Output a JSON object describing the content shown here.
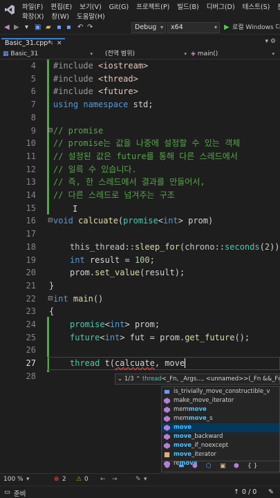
{
  "menu": {
    "row1": [
      "파일(F)",
      "편집(E)",
      "보기(V)",
      "Git(G)",
      "프로젝트(P)",
      "빌드(B)",
      "디버그(D)",
      "테스트(S)",
      "분석"
    ],
    "row2": [
      "확장(X)",
      "창(W)",
      "도움말(H)"
    ]
  },
  "toolbar": {
    "config": "Debug",
    "platform": "x64",
    "run_label": "로컬 Windows 디"
  },
  "tab": {
    "title": "Basic_31.cpp*"
  },
  "navbar": {
    "project": "Basic_31",
    "scope": "(전역 범위)",
    "member": "main()"
  },
  "editor": {
    "line_numbers": [
      "4",
      "5",
      "6",
      "7",
      "8",
      "9",
      "10",
      "11",
      "12",
      "13",
      "14",
      "15",
      "16",
      "17",
      "18",
      "19",
      "20",
      "21",
      "22",
      "23",
      "24",
      "25",
      "26",
      "27",
      "28"
    ],
    "current_line": "27",
    "lines": {
      "l4a": "#include ",
      "l4b": "<iostream>",
      "l5a": "#include ",
      "l5b": "<thread>",
      "l6a": "#include ",
      "l6b": "<future>",
      "l7a": "using namespace ",
      "l7b": "std;",
      "l9": "// promise",
      "l10": "// promise는 값을 나중에 설정할 수 있는 객체",
      "l11": "// 설정된 값은 future를 통해 다른 스레드에서",
      "l12": "// 일륵 수 있습니다.",
      "l13": "// 즉, 한 스레드에서 결과를 만들어서,",
      "l14": "// 다른 스레드로 넘겨주는 구조",
      "l16a": "void ",
      "l16b": "calcuate",
      "l16c": "(",
      "l16d": "promise",
      "l16e": "<",
      "l16f": "int",
      "l16g": "> prom)",
      "l18a": "this_thread",
      "l18b": "::",
      "l18c": "sleep_for",
      "l18d": "(",
      "l18e": "chrono",
      "l18f": "::",
      "l18g": "seconds",
      "l18h": "(",
      "l18i": "2",
      "l18j": "));",
      "l19a": "int ",
      "l19b": "result = ",
      "l19c": "100",
      "l19d": ";",
      "l20a": "prom.",
      "l20b": "set_value",
      "l20c": "(result);",
      "l21": "}",
      "l22a": "int ",
      "l22b": "main",
      "l22c": "()",
      "l23": "{",
      "l24a": "promise",
      "l24b": "<",
      "l24c": "int",
      "l24d": "> prom;",
      "l25a": "future",
      "l25b": "<",
      "l25c": "int",
      "l25d": "> fut = prom.",
      "l25e": "get_future",
      "l25f": "();",
      "l27a": "thread ",
      "l27b": "t(",
      "l27c": "calcuate",
      "l27d": ", move"
    }
  },
  "param_hint": {
    "counter": "1/3",
    "signature_a": "thread",
    "signature_b": "<_Fn, _Args..., <unnamed>>(_Fn &&_Fn, _Ar"
  },
  "completion": {
    "items": [
      {
        "pre": "is_trivially_",
        "match": "move",
        "post": "_constructible_v"
      },
      {
        "pre": "make_",
        "match": "move",
        "post": "_iterator"
      },
      {
        "pre": "mem",
        "match": "move",
        "post": ""
      },
      {
        "pre": "mem",
        "match": "move",
        "post": "_s"
      },
      {
        "pre": "",
        "match": "move",
        "post": ""
      },
      {
        "pre": "",
        "match": "move",
        "post": "_backward"
      },
      {
        "pre": "",
        "match": "move",
        "post": "_if_noexcept"
      },
      {
        "pre": "",
        "match": "move",
        "post": "_iterator"
      },
      {
        "pre": "re",
        "match": "move",
        "post": ""
      }
    ],
    "filter_braces": "{ }"
  },
  "editor_status": {
    "zoom": "100 %",
    "errors": "2",
    "warnings": "0"
  },
  "statusbar": {
    "ready": "준비",
    "problems": "0 / 0",
    "up": "↑"
  },
  "colors": {
    "keyword": "#569cd6",
    "comment": "#57a64a",
    "function": "#dcdcaa",
    "type": "#4ec9b0",
    "completion_match": "#4fc1ff",
    "tab_accent": "#3e7fd6"
  }
}
